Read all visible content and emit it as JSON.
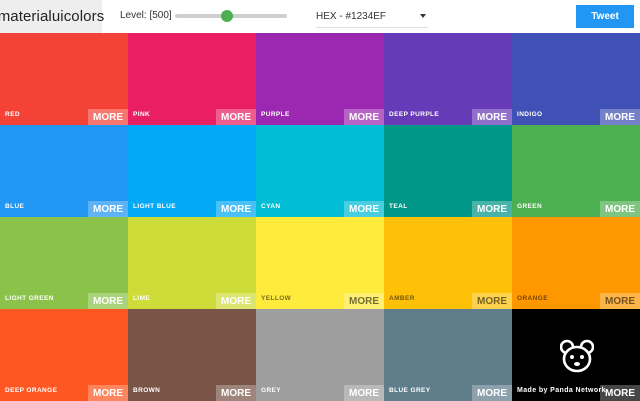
{
  "header": {
    "logo": "materialuicolors",
    "level_label": "Level: [500]",
    "format_selected": "HEX - #1234EF",
    "tweet_label": "Tweet"
  },
  "more_label": "MORE",
  "tiles": [
    {
      "name": "RED",
      "color": "#f44336",
      "text": "light"
    },
    {
      "name": "PINK",
      "color": "#e91e63",
      "text": "light"
    },
    {
      "name": "PURPLE",
      "color": "#9c27b0",
      "text": "light"
    },
    {
      "name": "DEEP PURPLE",
      "color": "#673ab7",
      "text": "light"
    },
    {
      "name": "INDIGO",
      "color": "#3f51b5",
      "text": "light"
    },
    {
      "name": "BLUE",
      "color": "#2196f3",
      "text": "light"
    },
    {
      "name": "LIGHT BLUE",
      "color": "#03a9f4",
      "text": "light"
    },
    {
      "name": "CYAN",
      "color": "#00bcd4",
      "text": "light"
    },
    {
      "name": "TEAL",
      "color": "#009688",
      "text": "light"
    },
    {
      "name": "GREEN",
      "color": "#4caf50",
      "text": "light"
    },
    {
      "name": "LIGHT GREEN",
      "color": "#8bc34a",
      "text": "light"
    },
    {
      "name": "LIME",
      "color": "#cddc39",
      "text": "light"
    },
    {
      "name": "YELLOW",
      "color": "#ffeb3b",
      "text": "dark"
    },
    {
      "name": "AMBER",
      "color": "#ffc107",
      "text": "dark"
    },
    {
      "name": "ORANGE",
      "color": "#ff9800",
      "text": "dark"
    },
    {
      "name": "DEEP ORANGE",
      "color": "#ff5722",
      "text": "light"
    },
    {
      "name": "BROWN",
      "color": "#795548",
      "text": "light"
    },
    {
      "name": "GREY",
      "color": "#9e9e9e",
      "text": "light"
    },
    {
      "name": "BLUE GREY",
      "color": "#607d8b",
      "text": "light"
    },
    {
      "name": "Made by Panda Network",
      "color": "#000000",
      "text": "light",
      "special": "panda"
    }
  ],
  "colors": {
    "accent": "#4caf50",
    "tweet_bg": "#2196f3",
    "logo_bg": "#eeeeee"
  },
  "icons": {
    "panda": "panda-icon",
    "dropdown": "chevron-down-icon"
  }
}
